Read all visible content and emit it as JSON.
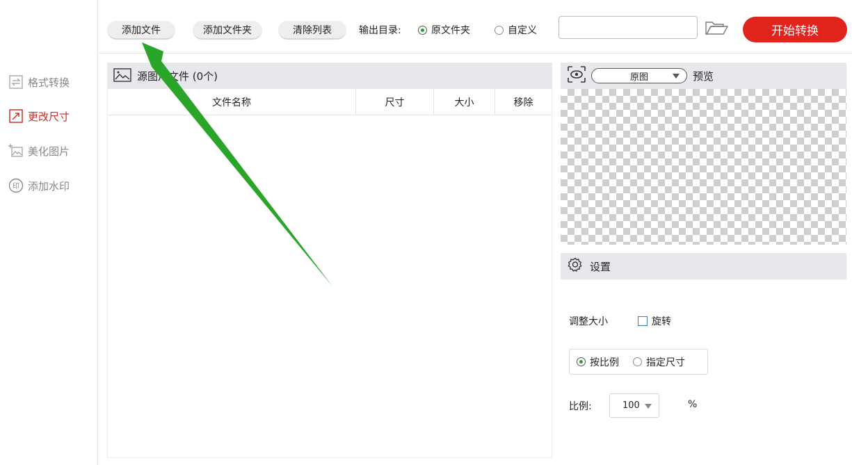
{
  "sidebar": {
    "items": [
      {
        "label": "格式转换",
        "icon": "swap-arrows-icon",
        "active": false
      },
      {
        "label": "更改尺寸",
        "icon": "resize-icon",
        "active": true
      },
      {
        "label": "美化图片",
        "icon": "sparkle-image-icon",
        "active": false
      },
      {
        "label": "添加水印",
        "icon": "watermark-stamp-icon",
        "active": false
      }
    ]
  },
  "toolbar": {
    "add_file": "添加文件",
    "add_folder": "添加文件夹",
    "clear_list": "清除列表",
    "output_label": "输出目录:",
    "radio_original": "原文件夹",
    "radio_custom": "自定义",
    "output_path": "",
    "start": "开始转换"
  },
  "file_panel": {
    "title": "源图片文件 (0个)",
    "columns": [
      "文件名称",
      "尺寸",
      "大小",
      "移除"
    ],
    "rows": []
  },
  "preview": {
    "select_value": "原图",
    "label": "预览"
  },
  "settings": {
    "title": "设置",
    "resize_label": "调整大小",
    "rotate_label": "旋转",
    "by_ratio": "按比例",
    "by_size": "指定尺寸",
    "ratio_label": "比例:",
    "ratio_value": "100",
    "percent": "%"
  },
  "colors": {
    "accent_red": "#e0241c",
    "active_text": "#c8302b",
    "annotation_arrow": "#2aa52a"
  }
}
